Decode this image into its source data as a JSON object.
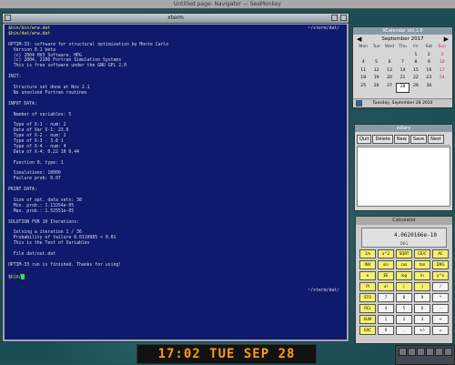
{
  "browser": {
    "title": "Untitled page: Navigator — SeaMonkey"
  },
  "xterm": {
    "title": "xterm",
    "prompt_right": "~/xterm/dat/",
    "prompt_right2": "~/xterm/dat/",
    "lines": [
      "$bin/bin/wrw.dat",
      "$bin/dat/wrw.dat",
      "",
      "OPTIM-33: software for structural optimization by Monte Carlo",
      "  Version 0.1 beta",
      "  (c) 2004 HV3 Software, HPG",
      "  (c) 2004, 2106 Fortran Simulation Systems",
      "  This is free software under the GNU GPL 2.0",
      "",
      "INIT:",
      "",
      "  Structure set done at Nov 2.1",
      "  No unsolved Fortran routines",
      "",
      "INPUT DATA:",
      "",
      "  Number of variables: 5",
      "",
      "  Type of X-1 - num: 2",
      "  Data of Var X-1: 23.0",
      "  Type of X-2 - num: 2",
      "  Type of X-3 - 3.8 1",
      "  Type of X-4 - num: 4",
      "  Data of X-4: 0.22 10 0.44",
      "",
      "  Function 0, type: 1",
      "",
      "  Simulations: 10000",
      "  Failure prob: 0.07",
      "",
      "PRINT DATA:",
      "",
      "  Size of opt. data sets: 38",
      "  Min. prob.: 1.13254e-05",
      "  Max. prob.: 1.52551e-05",
      "",
      "SOLUTION FOR 10 Iterations:",
      "",
      "  Solving a iteration 1 / 36",
      "  Probability of failure 0.0110985 < 0.01",
      "  This is the Test of Variables",
      "",
      "  File dat/out.dat",
      "",
      "OPTIM-33 run is finished. Thanks for using!",
      ""
    ],
    "prompt": "$bin/"
  },
  "calendar": {
    "title": "XCalendar Vol.1.0",
    "month_label": "September 2017",
    "weekday_headers": [
      "Mon",
      "Tue",
      "Wed",
      "Thu",
      "Fri",
      "Sat",
      "Sun"
    ],
    "days": [
      "",
      "",
      "",
      "",
      "1",
      "2",
      "3",
      "4",
      "5",
      "6",
      "7",
      "8",
      "9",
      "10",
      "11",
      "12",
      "13",
      "14",
      "15",
      "16",
      "17",
      "18",
      "19",
      "20",
      "21",
      "22",
      "23",
      "24",
      "25",
      "26",
      "27",
      "28",
      "29",
      "30",
      ""
    ],
    "today": "28",
    "footer": "Tuesday, September 28 2010"
  },
  "xedit": {
    "title": "xdiary",
    "buttons": [
      "Quit",
      "Delete",
      "New",
      "Save",
      "Next"
    ]
  },
  "calculator": {
    "title": "Calculator",
    "display": "4.0620166e-10",
    "mode": "DEG",
    "keys": [
      {
        "label": "1/x",
        "style": "y"
      },
      {
        "label": "x^2",
        "style": "y"
      },
      {
        "label": "SQRT",
        "style": "y"
      },
      {
        "label": "CE/C",
        "style": "y"
      },
      {
        "label": "AC",
        "style": "y"
      },
      {
        "label": "INV",
        "style": "y"
      },
      {
        "label": "sin",
        "style": "y"
      },
      {
        "label": "cos",
        "style": "y"
      },
      {
        "label": "tan",
        "style": "y"
      },
      {
        "label": "DRG",
        "style": "y"
      },
      {
        "label": "e",
        "style": "y"
      },
      {
        "label": "EE",
        "style": "y"
      },
      {
        "label": "log",
        "style": "y"
      },
      {
        "label": "ln",
        "style": "y"
      },
      {
        "label": "y^x",
        "style": "y"
      },
      {
        "label": "PI",
        "style": "y"
      },
      {
        "label": "x!",
        "style": "y"
      },
      {
        "label": "(",
        "style": "y"
      },
      {
        "label": ")",
        "style": "y"
      },
      {
        "label": "/",
        "style": "w"
      },
      {
        "label": "STO",
        "style": "y"
      },
      {
        "label": "7",
        "style": "w"
      },
      {
        "label": "8",
        "style": "w"
      },
      {
        "label": "9",
        "style": "w"
      },
      {
        "label": "*",
        "style": "w"
      },
      {
        "label": "RCL",
        "style": "y"
      },
      {
        "label": "4",
        "style": "w"
      },
      {
        "label": "5",
        "style": "w"
      },
      {
        "label": "6",
        "style": "w"
      },
      {
        "label": "-",
        "style": "w"
      },
      {
        "label": "SUM",
        "style": "y"
      },
      {
        "label": "1",
        "style": "w"
      },
      {
        "label": "2",
        "style": "w"
      },
      {
        "label": "3",
        "style": "w"
      },
      {
        "label": "+",
        "style": "w"
      },
      {
        "label": "EXC",
        "style": "y"
      },
      {
        "label": "0",
        "style": "w"
      },
      {
        "label": ".",
        "style": "w"
      },
      {
        "label": "+/-",
        "style": "w"
      },
      {
        "label": "=",
        "style": "w"
      }
    ]
  },
  "clock": {
    "text": "17:02 TUE SEP 28"
  },
  "colors": {
    "terminal_bg": "#0e1a6b",
    "clock_fg": "#ff9a12",
    "calc_key": "#f6f06a"
  }
}
